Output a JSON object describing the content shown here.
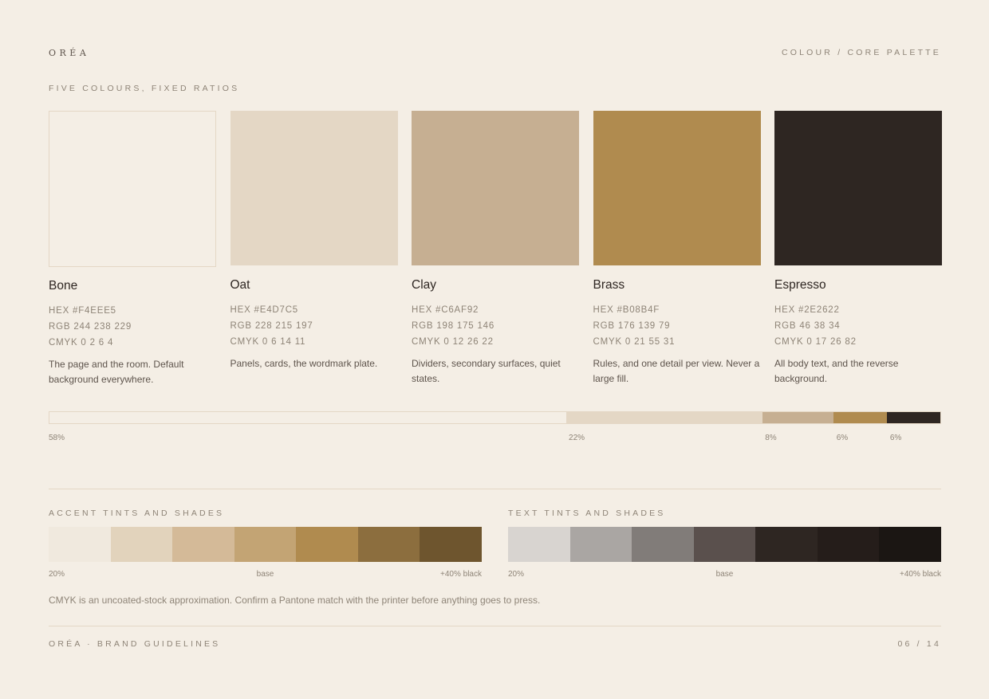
{
  "header": {
    "brand": "ORÉA",
    "crumb": "COLOUR / CORE PALETTE"
  },
  "section_label": "FIVE COLOURS, FIXED RATIOS",
  "swatches": [
    {
      "name": "Bone",
      "hex": "HEX #F4EEE5",
      "rgb": "RGB 244 238 229",
      "cmyk": "CMYK 0 2 6 4",
      "desc": "The page and the room. Default background everywhere.",
      "color": "#F4EEE5"
    },
    {
      "name": "Oat",
      "hex": "HEX #E4D7C5",
      "rgb": "RGB 228 215 197",
      "cmyk": "CMYK 0 6 14 11",
      "desc": "Panels, cards, the wordmark plate.",
      "color": "#E4D7C5"
    },
    {
      "name": "Clay",
      "hex": "HEX #C6AF92",
      "rgb": "RGB 198 175 146",
      "cmyk": "CMYK 0 12 26 22",
      "desc": "Dividers, secondary surfaces, quiet states.",
      "color": "#C6AF92"
    },
    {
      "name": "Brass",
      "hex": "HEX #B08B4F",
      "rgb": "RGB 176 139 79",
      "cmyk": "CMYK 0 21 55 31",
      "desc": "Rules, and one detail per view. Never a large fill.",
      "color": "#B08B4F"
    },
    {
      "name": "Espresso",
      "hex": "HEX #2E2622",
      "rgb": "RGB 46 38 34",
      "cmyk": "CMYK 0 17 26 82",
      "desc": "All body text, and the reverse background.",
      "color": "#2E2622"
    }
  ],
  "ratio": [
    {
      "label": "58%",
      "value": 58,
      "color": "#F4EEE5"
    },
    {
      "label": "22%",
      "value": 22,
      "color": "#E4D7C5"
    },
    {
      "label": "8%",
      "value": 8,
      "color": "#C6AF92"
    },
    {
      "label": "6%",
      "value": 6,
      "color": "#B08B4F"
    },
    {
      "label": "6%",
      "value": 6,
      "color": "#2E2622"
    }
  ],
  "accent_tints": {
    "title": "ACCENT TINTS AND SHADES",
    "colors": [
      "#F0E9DE",
      "#E2D3BC",
      "#D4BA98",
      "#C3A474",
      "#B08B4F",
      "#8C6E3E",
      "#6E552E"
    ],
    "label_left": "20%",
    "label_mid": "base",
    "label_right": "+40% black"
  },
  "text_tints": {
    "title": "TEXT TINTS AND SHADES",
    "colors": [
      "#D8D4D0",
      "#AAA6A3",
      "#817C79",
      "#5A504D",
      "#2E2622",
      "#251D1A",
      "#1B1613"
    ],
    "label_left": "20%",
    "label_mid": "base",
    "label_right": "+40% black"
  },
  "note": "CMYK is an uncoated-stock approximation. Confirm a Pantone match with the printer before anything goes to press.",
  "footer": {
    "left": "ORÉA · BRAND GUIDELINES",
    "right": "06 / 14"
  }
}
